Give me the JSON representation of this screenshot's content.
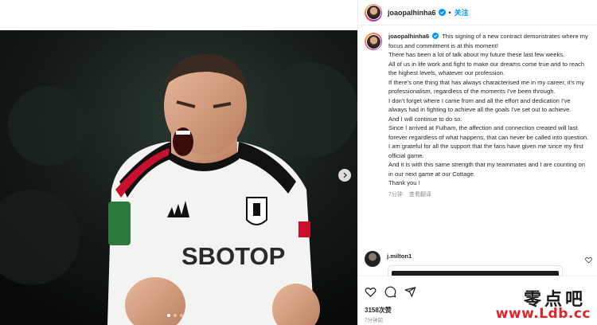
{
  "header": {
    "username": "joaopalhinha6",
    "separator": "•",
    "follow_label": "关注"
  },
  "caption": {
    "username": "joaopalhinha6",
    "lines": [
      "This signing of a new contract demonstrates where my focus and commitment is at this moment!",
      "There has been a lot of talk about my future these last few weeks.",
      "All of us in life work and fight to make our dreams come true and to reach the highest levels, whatever our profession.",
      "If there's one thing that has always characterised me in my career, it's my professionalism, regardless of the moments I've been through.",
      "I don't forget where I came from and all the effort and dedication I've always had in fighting to achieve all the goals I've set out to achieve.",
      "And I will continue to do so.",
      "Since I arrived at Fulham, the affection and connection created will last forever regardless of what happens, that can never be called into question.",
      "I am grateful for all the support that the fans have given me since my first official game.",
      "And it is with this same strength that my teammates and I are counting on in our next game at our Cottage.",
      "Thank you !"
    ],
    "time": "7分钟",
    "translate_label": "查看翻译"
  },
  "comment": {
    "username": "j.milton1"
  },
  "footer": {
    "views": "3158次赞",
    "time": "7分钟前"
  },
  "watermark": {
    "cn": "零点吧",
    "url": "www.Ldb.cc"
  },
  "media": {
    "shirt_sponsor": "SBOTOP",
    "carousel_dots": 3,
    "active_dot": 0
  },
  "colors": {
    "accent": "#0095f6",
    "verified": "#0095f6",
    "watermark_red": "#e0242a"
  }
}
